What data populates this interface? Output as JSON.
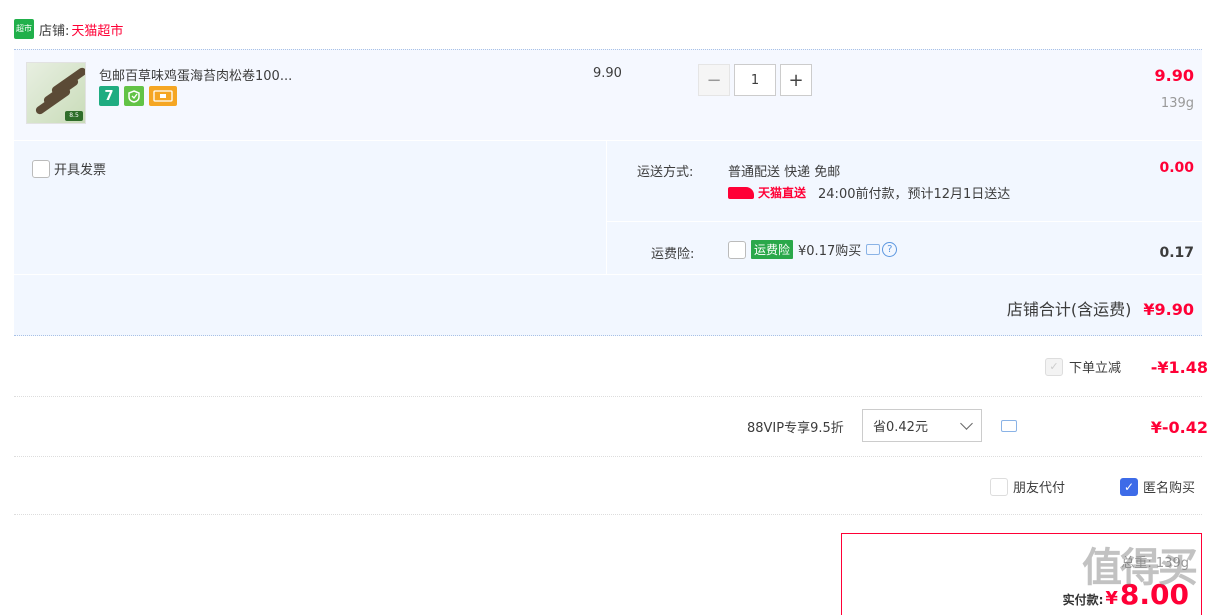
{
  "store": {
    "logo_text": "超市",
    "prefix": "店铺:",
    "name": "天猫超市"
  },
  "item": {
    "title": "包邮百草味鸡蛋海苔肉松卷100...",
    "tag_icons": [
      "seven-day-return-icon",
      "guarantee-icon",
      "card-icon"
    ],
    "tag_seven": "7",
    "unit_price": "9.90",
    "quantity": "1",
    "decrease_symbol": "−",
    "increase_symbol": "+",
    "line_total": "9.90",
    "weight": "139g",
    "thumb_badge": "8.5"
  },
  "service": {
    "invoice_label": "开具发票",
    "shipping_label": "运送方式:",
    "shipping_desc": "普通配送 快递 免邮",
    "shipping_fee": "0.00",
    "tmall_direct": "天猫直送",
    "delivery_note": "24:00前付款，预计12月1日送达",
    "insurance_label": "运费险:",
    "insurance_tag": "运费险",
    "insurance_price": "¥0.17购买",
    "insurance_fee": "0.17"
  },
  "store_total": {
    "label": "店铺合计(含运费)",
    "amount": "¥9.90"
  },
  "discount": {
    "label": "下单立减",
    "amount": "-¥1.48"
  },
  "vip": {
    "label": "88VIP专享9.5折",
    "selected": "省0.42元",
    "amount": "¥-0.42"
  },
  "options": {
    "friend_pay": "朋友代付",
    "anonymous": "匿名购买"
  },
  "pay": {
    "weight": "总重: 139g",
    "label": "实付款:",
    "currency": "¥",
    "amount": "8.00"
  },
  "watermark": "值得买"
}
